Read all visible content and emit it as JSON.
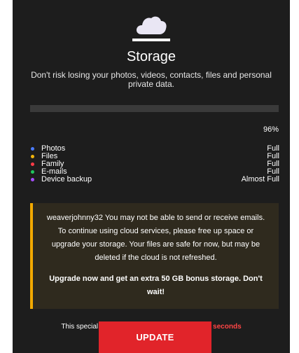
{
  "header": {
    "icon": "cloud-icon",
    "title": "Storage",
    "subtitle": "Don't risk losing your photos, videos, contacts, files and personal private data."
  },
  "storage": {
    "used_fraction": 0.96,
    "percent_label": "96%"
  },
  "items": [
    {
      "label": "Photos",
      "status": "Full",
      "color": "#4a7cff"
    },
    {
      "label": "Files",
      "status": "Full",
      "color": "#f2b50c"
    },
    {
      "label": "Family",
      "status": "Full",
      "color": "#ff3b47"
    },
    {
      "label": "E-mails",
      "status": "Full",
      "color": "#21c55d"
    },
    {
      "label": "Device backup",
      "status": "Almost Full",
      "color": "#a64dff"
    }
  ],
  "warning": {
    "body": "weaverjohnny32 You may not be able to send or receive emails. To continue using cloud services, please free up space or upgrade your storage. Your files are safe for now, but may be deleted if the cloud is not refreshed.",
    "cta": "Upgrade now and get an extra 50 GB bonus storage. Don't wait!",
    "accent_color": "#f2a900"
  },
  "offer": {
    "prefix": "This special",
    "timer": "39 seconds"
  },
  "update_button": {
    "label": "UPDATE",
    "color": "#e1242a"
  }
}
